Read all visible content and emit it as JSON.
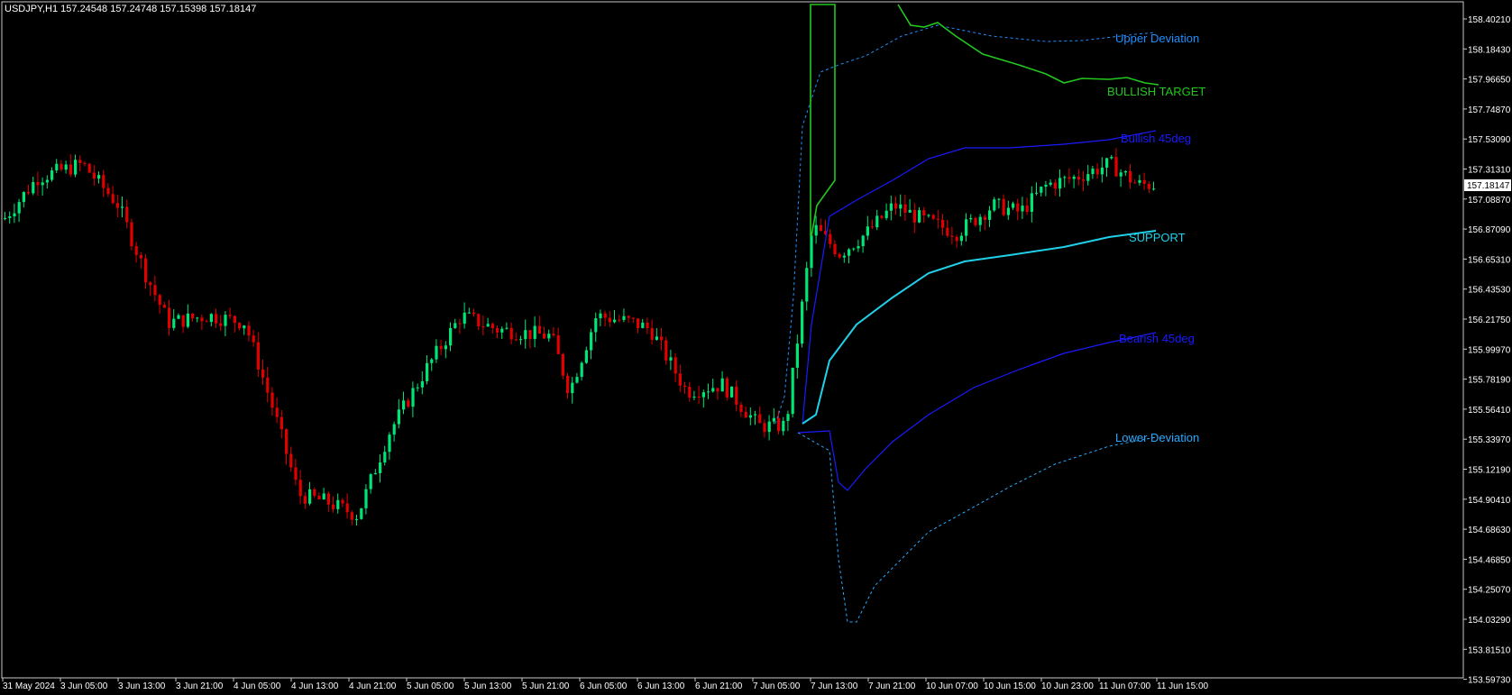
{
  "header": {
    "symbol_info": "USDJPY,H1  157.24548 157.24748 157.15398 157.18147"
  },
  "current_price": "157.18147",
  "price_axis": {
    "labels": [
      "158.40210",
      "158.18430",
      "157.96650",
      "157.74870",
      "157.53090",
      "157.31310",
      "157.08870",
      "156.87090",
      "156.65310",
      "156.43530",
      "156.21750",
      "155.99970",
      "155.78190",
      "155.56410",
      "155.33970",
      "155.12190",
      "154.90410",
      "154.68630",
      "154.46850",
      "154.25070",
      "154.03290",
      "153.81510",
      "153.59730"
    ]
  },
  "time_axis": {
    "labels": [
      "31 May 2024",
      "3 Jun 05:00",
      "3 Jun 13:00",
      "3 Jun 21:00",
      "4 Jun 05:00",
      "4 Jun 13:00",
      "4 Jun 21:00",
      "5 Jun 05:00",
      "5 Jun 13:00",
      "5 Jun 21:00",
      "6 Jun 05:00",
      "6 Jun 13:00",
      "6 Jun 21:00",
      "7 Jun 05:00",
      "7 Jun 13:00",
      "7 Jun 21:00",
      "10 Jun 07:00",
      "10 Jun 15:00",
      "10 Jun 23:00",
      "11 Jun 07:00",
      "11 Jun 15:00"
    ]
  },
  "indicator_labels": {
    "upper_deviation": "Upper Deviation",
    "bullish_target": "BULLISH TARGET",
    "bullish_45deg": "Bullish 45deg",
    "support": "SUPPORT",
    "bearish_45deg": "Bearish 45deg",
    "lower_deviation": "Lower Deviation"
  },
  "colors": {
    "background": "#000000",
    "bull_candle": "#00e676",
    "bear_candle": "#e00000",
    "upper_deviation": "#1e90ff",
    "bullish_target": "#22c81e",
    "bullish_45deg": "#1a1aff",
    "support": "#20d0e8",
    "bearish_45deg": "#1a1aff",
    "lower_deviation": "#29aaff",
    "axis_text": "#ffffff"
  },
  "chart_data": {
    "type": "candlestick",
    "symbol": "USDJPY",
    "timeframe": "H1",
    "ylim": [
      153.5973,
      158.4021
    ],
    "close_series": [
      {
        "x": "31 May 2024",
        "y": 156.95
      },
      {
        "x": "3 Jun 05:00",
        "y": 157.3
      },
      {
        "x": "3 Jun 13:00",
        "y": 157.1
      },
      {
        "x": "3 Jun 21:00",
        "y": 156.2
      },
      {
        "x": "4 Jun 05:00",
        "y": 156.35
      },
      {
        "x": "4 Jun 13:00",
        "y": 155.1
      },
      {
        "x": "4 Jun 21:00",
        "y": 154.8
      },
      {
        "x": "5 Jun 05:00",
        "y": 155.5
      },
      {
        "x": "5 Jun 13:00",
        "y": 156.15
      },
      {
        "x": "5 Jun 21:00",
        "y": 156.15
      },
      {
        "x": "6 Jun 05:00",
        "y": 155.7
      },
      {
        "x": "6 Jun 13:00",
        "y": 156.25
      },
      {
        "x": "6 Jun 21:00",
        "y": 155.75
      },
      {
        "x": "7 Jun 05:00",
        "y": 155.7
      },
      {
        "x": "7 Jun 13:00",
        "y": 156.9
      },
      {
        "x": "7 Jun 21:00",
        "y": 156.7
      },
      {
        "x": "10 Jun 07:00",
        "y": 157.0
      },
      {
        "x": "10 Jun 15:00",
        "y": 156.9
      },
      {
        "x": "10 Jun 23:00",
        "y": 157.05
      },
      {
        "x": "11 Jun 07:00",
        "y": 157.25
      },
      {
        "x": "11 Jun 15:00",
        "y": 157.18
      }
    ]
  }
}
